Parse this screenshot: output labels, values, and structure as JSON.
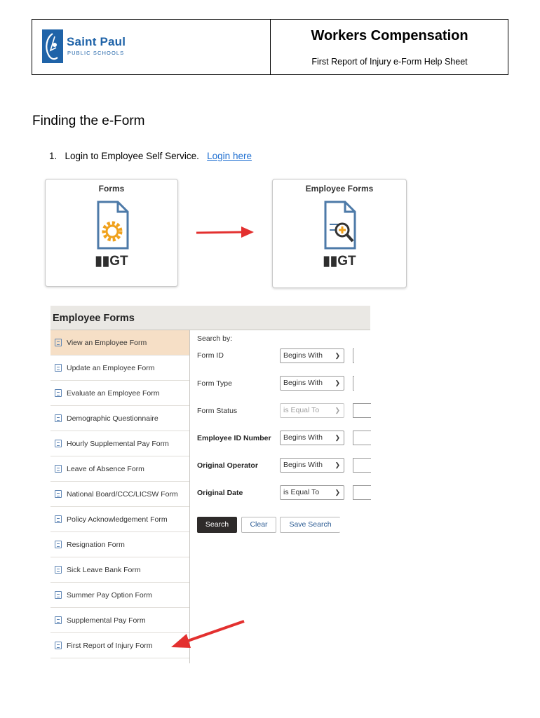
{
  "header": {
    "logo": {
      "name": "Saint Paul",
      "sub": "PUBLIC SCHOOLS"
    },
    "title": "Workers Compensation",
    "subtitle": "First Report of Injury e-Form Help Sheet"
  },
  "section_title": "Finding the e-Form",
  "steps": [
    {
      "number": "1.",
      "text": "Login to Employee Self Service.",
      "link": "Login here"
    }
  ],
  "tiles": [
    {
      "label": "Forms",
      "brand": "GT",
      "icon": "document-gear-icon"
    },
    {
      "label": "Employee Forms",
      "brand": "GT",
      "icon": "document-search-icon"
    }
  ],
  "employee_forms": {
    "title": "Employee Forms",
    "nav_items": [
      "View an Employee Form",
      "Update an Employee Form",
      "Evaluate an Employee Form",
      "Demographic Questionnaire",
      "Hourly Supplemental Pay Form",
      "Leave of Absence Form",
      "National Board/CCC/LICSW Form",
      "Policy Acknowledgement Form",
      "Resignation Form",
      "Sick Leave Bank Form",
      "Summer Pay Option Form",
      "Supplemental Pay Form",
      "First Report of Injury Form"
    ],
    "search_by_label": "Search by:",
    "fields": [
      {
        "label": "Form ID",
        "operator": "Begins With"
      },
      {
        "label": "Form Type",
        "operator": "Begins With"
      },
      {
        "label": "Form Status",
        "operator": "is Equal To"
      },
      {
        "label": "Employee ID Number",
        "operator": "Begins With"
      },
      {
        "label": "Original Operator",
        "operator": "Begins With"
      },
      {
        "label": "Original Date",
        "operator": "is Equal To"
      }
    ],
    "buttons": {
      "search": "Search",
      "clear": "Clear",
      "save_search": "Save Search"
    }
  },
  "colors": {
    "accent": "#1f63a8",
    "arrow": "#e3302f",
    "selected": "#f6dfc6",
    "panel_bar": "#eae8e4"
  }
}
